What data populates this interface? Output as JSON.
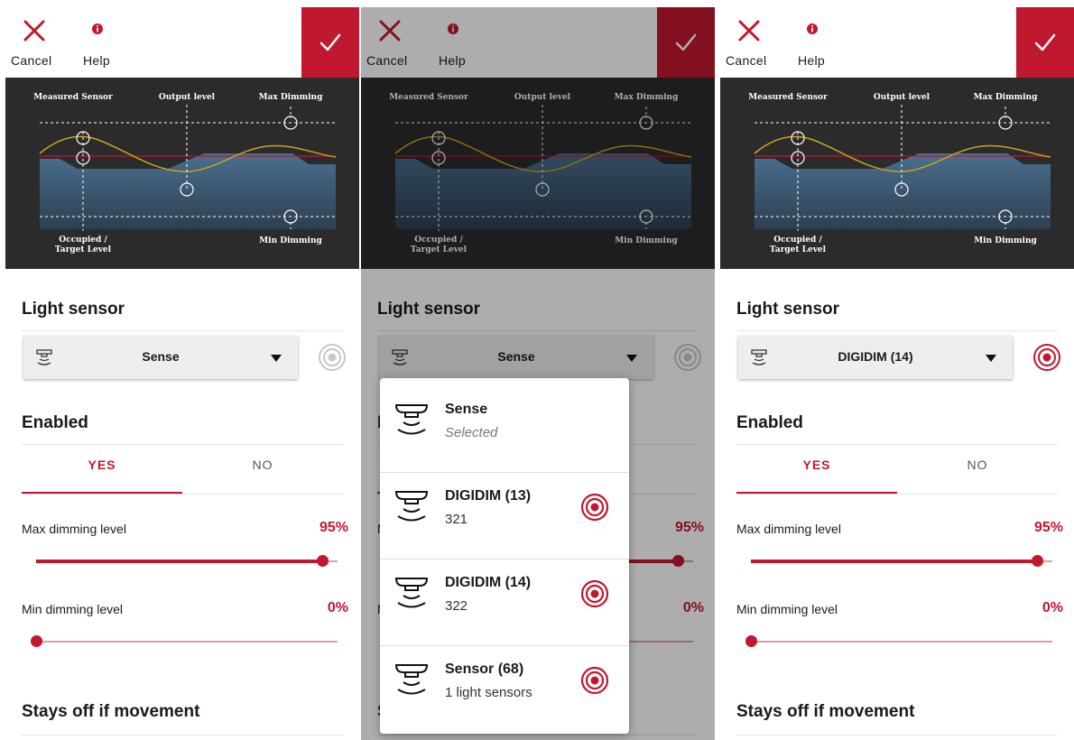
{
  "header": {
    "cancel_label": "Cancel",
    "help_label": "Help"
  },
  "diagram": {
    "measured_sensor": "Measured Sensor",
    "output_level": "Output level",
    "max_dimming": "Max Dimming",
    "occupied_line1": "Occupied /",
    "occupied_line2": "Target Level",
    "min_dimming": "Min Dimming"
  },
  "light_sensor_title": "Light sensor",
  "enabled_title": "Enabled",
  "tabs": {
    "yes": "YES",
    "no": "NO"
  },
  "max_dimming": {
    "label": "Max dimming level",
    "value": "95%",
    "fraction": 0.95
  },
  "min_dimming": {
    "label": "Min dimming level",
    "value": "0%",
    "fraction": 0.0
  },
  "stays_off_title": "Stays off if movement",
  "panels": [
    {
      "selected_sensor": "Sense"
    },
    {
      "selected_sensor": "Sense"
    },
    {
      "selected_sensor": "DIGIDIM (14)"
    }
  ],
  "dropdown_items": [
    {
      "name": "Sense",
      "sub": "Selected",
      "icon": "sensor-icon",
      "identify": false
    },
    {
      "name": "DIGIDIM (13)",
      "sub": "321",
      "icon": "sensor-icon",
      "identify": true
    },
    {
      "name": "DIGIDIM (14)",
      "sub": "322",
      "icon": "sensor-icon",
      "identify": true
    },
    {
      "name": "Sensor (68)",
      "sub": "1 light sensors",
      "icon": "sensor-icon",
      "identify": true
    }
  ],
  "colors": {
    "accent": "#c0182f",
    "diagram_bg": "#2b2b2b",
    "area": "#41627f",
    "curve": "#c9a21b"
  },
  "icons": {
    "cancel": "close-icon",
    "help": "info-icon",
    "confirm": "check-icon",
    "identify": "target-icon"
  }
}
